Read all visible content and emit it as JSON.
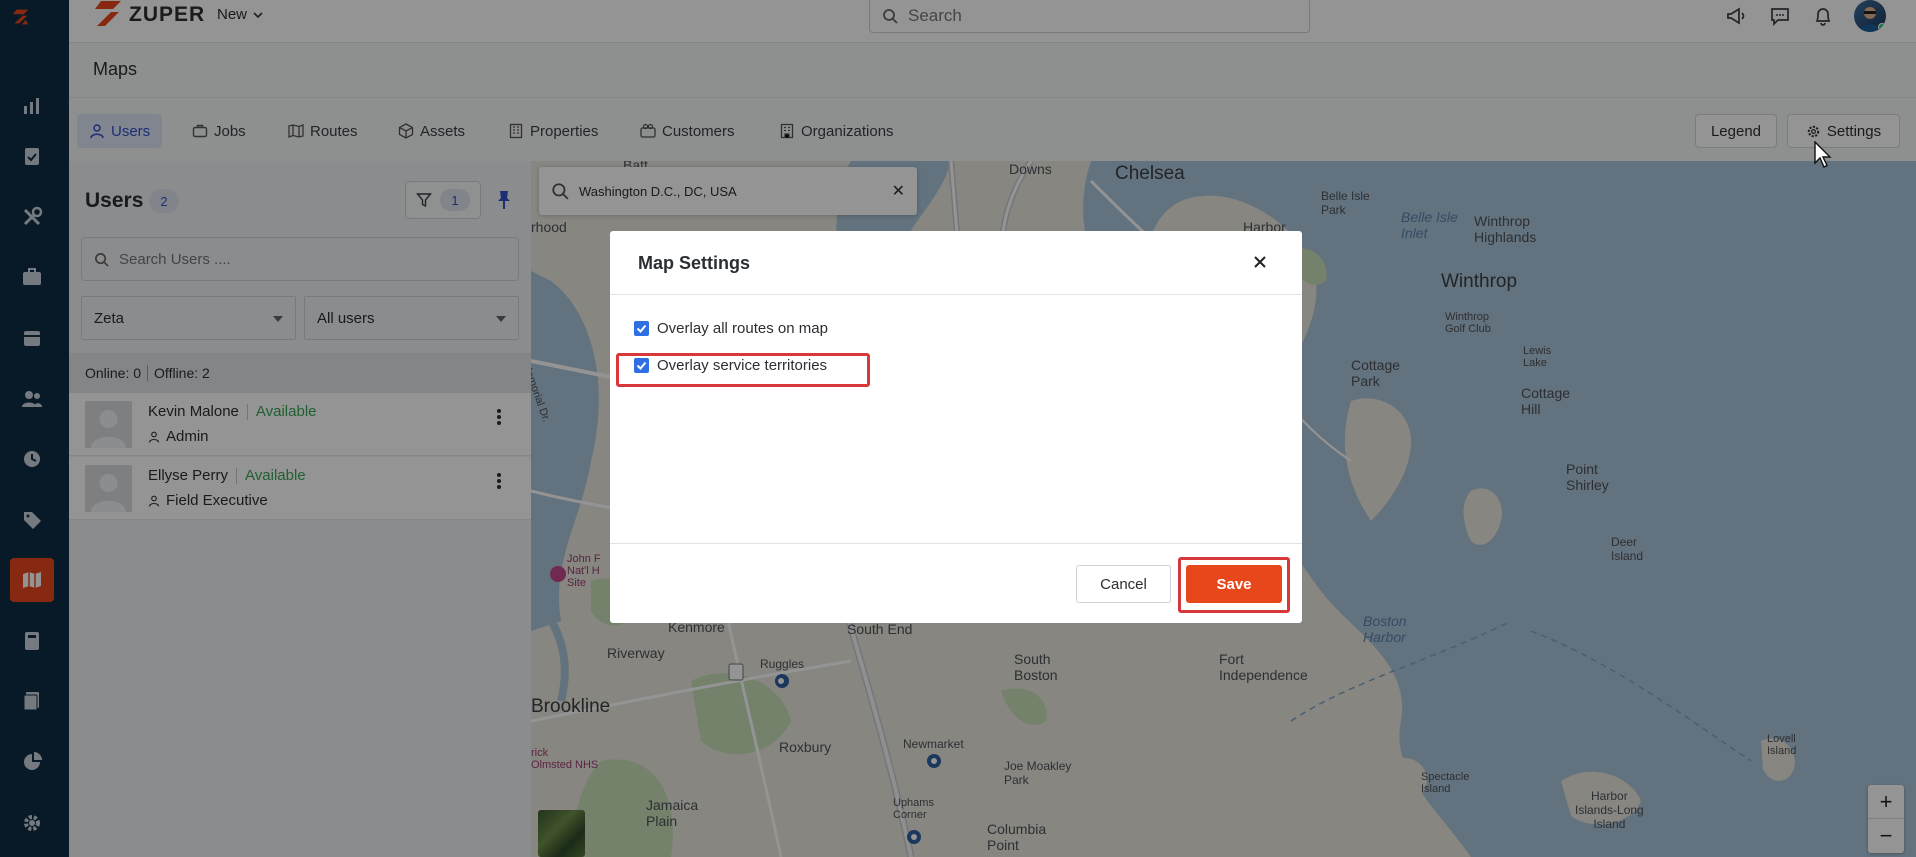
{
  "app": {
    "brand": "ZUPER",
    "new_label": "New",
    "search_placeholder": "Search"
  },
  "page": {
    "title": "Maps"
  },
  "tabs": [
    {
      "label": "Users",
      "icon": "user-icon",
      "active": true
    },
    {
      "label": "Jobs",
      "icon": "briefcase-icon"
    },
    {
      "label": "Routes",
      "icon": "map-icon"
    },
    {
      "label": "Assets",
      "icon": "cube-icon"
    },
    {
      "label": "Properties",
      "icon": "building-icon"
    },
    {
      "label": "Customers",
      "icon": "customers-icon"
    },
    {
      "label": "Organizations",
      "icon": "organization-icon"
    }
  ],
  "header_buttons": {
    "legend": "Legend",
    "settings": "Settings"
  },
  "users_panel": {
    "title": "Users",
    "count": "2",
    "filter_count": "1",
    "search_placeholder": "Search Users ....",
    "team_select": "Zeta",
    "user_select": "All users",
    "online": "Online: 0",
    "offline": "Offline: 2",
    "users": [
      {
        "name": "Kevin Malone",
        "status": "Available",
        "role": "Admin"
      },
      {
        "name": "Ellyse Perry",
        "status": "Available",
        "role": "Field Executive"
      }
    ]
  },
  "map": {
    "search_value": "Washington D.C., DC, USA",
    "labels": {
      "chelsea": "Chelsea",
      "downs": "Downs",
      "belle_isle": "Belle Isle\nPark",
      "belle_inlet": "Belle Isle\nInlet",
      "winthrop_highlands": "Winthrop\nHighlands",
      "harbor": "Harbor",
      "winthrop": "Winthrop",
      "winthrop_golf": "Winthrop\nGolf Club",
      "lewis_lake": "Lewis\nLake",
      "cottage_park": "Cottage\nPark",
      "cottage_hill": "Cottage\nHill",
      "point_shirley": "Point\nShirley",
      "deer_island": "Deer\nIsland",
      "boston_harbor": "Boston\nHarbor",
      "fort_independence": "Fort\nIndependence",
      "south_boston": "South\nBoston",
      "south_end": "South End",
      "kenmore": "Kenmore",
      "riverway": "Riverway",
      "ruggles": "Ruggles",
      "brookline": "Brookline",
      "roxbury": "Roxbury",
      "newmarket": "Newmarket",
      "joe_moakley": "Joe Moakley\nPark",
      "jamaica_plain": "Jamaica\nPlain",
      "uphams": "Uphams\nCorner",
      "columbia_point": "Columbia\nPoint",
      "spectacle": "Spectacle\nIsland",
      "harbor_islands": "Harbor\nIslands-Long\nIsland",
      "lovell": "Lovell\nIsland",
      "john_f": "John F\nNat'l H\nSite",
      "olmsted": "rick\nOlmsted NHS",
      "memorial": "Memorial Dr.",
      "batt": "Batt",
      "hood": "rhood",
      "zoom_in": "+",
      "zoom_out": "−"
    }
  },
  "modal": {
    "title": "Map Settings",
    "options": [
      {
        "label": "Overlay all routes on map",
        "checked": true
      },
      {
        "label": "Overlay service territories",
        "checked": true
      }
    ],
    "cancel": "Cancel",
    "save": "Save"
  },
  "colors": {
    "rail": "#0f2d45",
    "accent": "#e8471c",
    "active_tab": "#3350c9",
    "available": "#3aa655",
    "highlight": "#d9383a"
  }
}
